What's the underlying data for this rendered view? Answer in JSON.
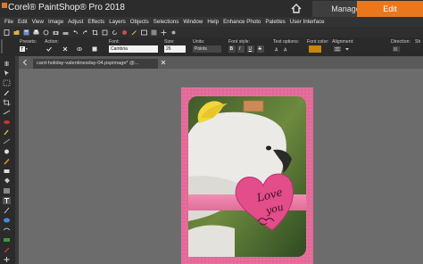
{
  "app": {
    "title": "Corel® PaintShop® Pro 2018",
    "tabs": [
      {
        "label": "Manage",
        "active": false
      },
      {
        "label": "Edit",
        "active": true
      }
    ],
    "accent_color": "#e8771e"
  },
  "menu": [
    "File",
    "Edit",
    "View",
    "Image",
    "Adjust",
    "Effects",
    "Layers",
    "Objects",
    "Selections",
    "Window",
    "Help",
    "Enhance Photo",
    "Palettes",
    "User Interface"
  ],
  "tool_options": {
    "labels": {
      "presets": "Presets:",
      "action": "Action:",
      "font": "Font:",
      "size": "Size:",
      "units": "Units:",
      "font_style": "Font style:",
      "text_options": "Text options:",
      "font_color": "Font color:",
      "alignment": "Alignment:",
      "direction": "Direction:",
      "show": "Sh"
    },
    "font_value": "Cambria",
    "size_value": "26",
    "units_value": "Points",
    "font_color_hex": "#c8860a"
  },
  "document": {
    "tab_label": "card-holiday-valentinesday-04.pspimage* @..."
  },
  "card": {
    "bg_color": "#e66f9c",
    "heart_color": "#e24d8a",
    "heart_text_line1": "Love",
    "heart_text_line2": "you"
  }
}
